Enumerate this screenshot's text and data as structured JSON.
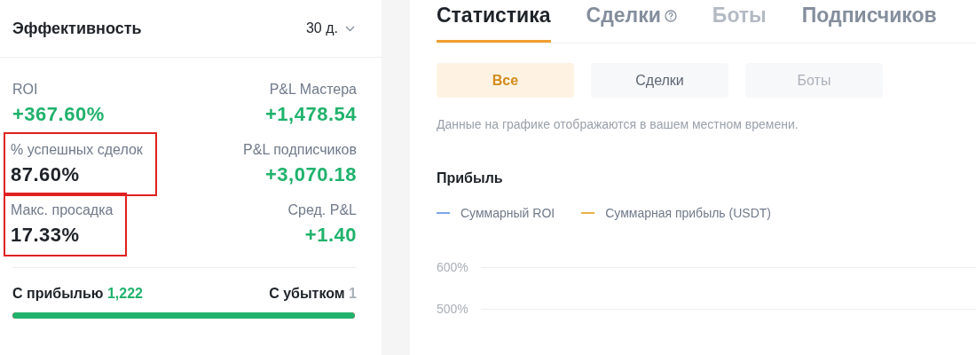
{
  "performance": {
    "title": "Эффективность",
    "period": "30 д.",
    "metrics": [
      {
        "label": "ROI",
        "value": "+367.60%",
        "positive": true,
        "highlighted": false
      },
      {
        "label": "P&L Мастера",
        "value": "+1,478.54",
        "positive": true,
        "highlighted": false
      },
      {
        "label": "% успешных сделок",
        "value": "87.60%",
        "positive": false,
        "highlighted": true
      },
      {
        "label": "P&L подписчиков",
        "value": "+3,070.18",
        "positive": true,
        "highlighted": false
      },
      {
        "label": "Макс. просадка",
        "value": "17.33%",
        "positive": false,
        "highlighted": true
      },
      {
        "label": "Сред. P&L",
        "value": "+1.40",
        "positive": true,
        "highlighted": false
      }
    ],
    "profit_label": "С прибылью",
    "profit_count": "1,222",
    "loss_label": "С убытком",
    "loss_count": "1",
    "level": 0.999
  },
  "tabs": [
    {
      "label": "Статистика",
      "selected": true,
      "disabled": false,
      "help": false
    },
    {
      "label": "Сделки",
      "selected": false,
      "disabled": false,
      "help": true
    },
    {
      "label": "Боты",
      "selected": false,
      "disabled": true,
      "help": false
    },
    {
      "label": "Подписчиков",
      "selected": false,
      "disabled": false,
      "help": false
    }
  ],
  "filters": [
    {
      "label": "Все",
      "selected": true,
      "disabled": false
    },
    {
      "label": "Сделки",
      "selected": false,
      "disabled": false
    },
    {
      "label": "Боты",
      "selected": false,
      "disabled": true
    }
  ],
  "note": "Данные на графике отображаются в вашем местном времени.",
  "chart": {
    "title": "Прибыль",
    "legend": [
      {
        "label": "Суммарный ROI",
        "color": "#7aa7e8"
      },
      {
        "label": "Суммарная прибыль (USDT)",
        "color": "#e8b04a"
      }
    ],
    "yticks": [
      "600%",
      "500%"
    ]
  }
}
